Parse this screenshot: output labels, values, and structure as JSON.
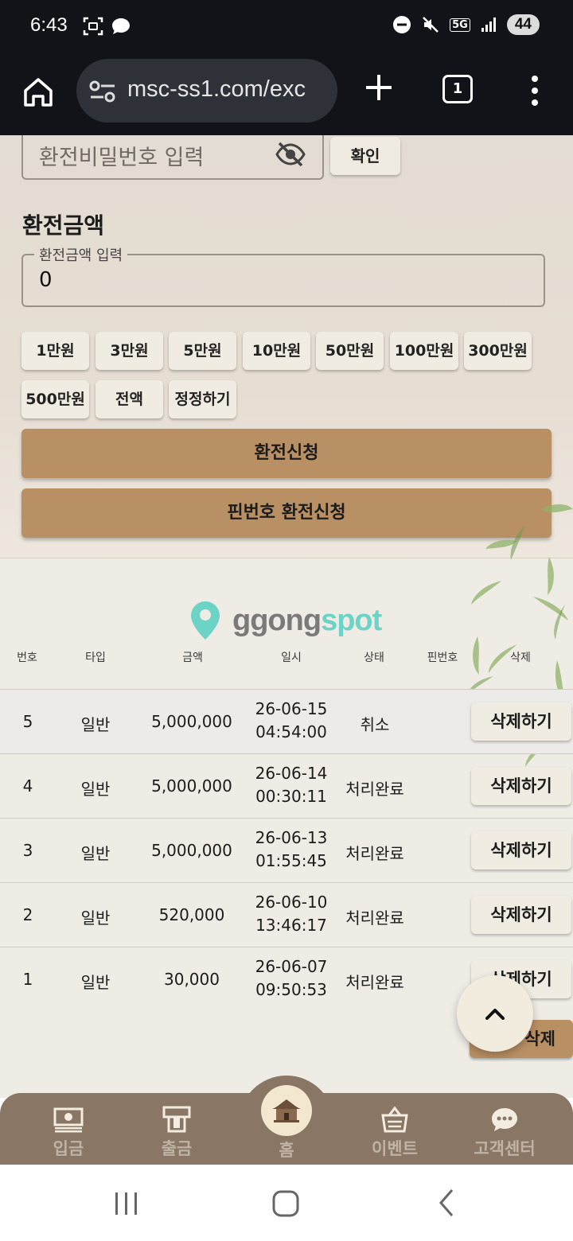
{
  "status_bar": {
    "time": "6:43",
    "network": "5G",
    "battery": "44"
  },
  "browser": {
    "url": "msc-ss1.com/exc",
    "tab_count": "1"
  },
  "form": {
    "password_placeholder": "환전비밀번호 입력",
    "confirm_label": "확인",
    "amount_title": "환전금액",
    "amount_legend": "환전금액 입력",
    "amount_value": "0",
    "chips": [
      "1만원",
      "3만원",
      "5만원",
      "10만원",
      "50만원",
      "100만원",
      "300만원",
      "500만원",
      "전액",
      "정정하기"
    ],
    "exchange_request_label": "환전신청",
    "pin_exchange_label": "핀번호 환전신청"
  },
  "logo": {
    "part1": "ggong",
    "part2": "spot"
  },
  "table": {
    "headers": [
      "번호",
      "타입",
      "금액",
      "일시",
      "상태",
      "핀번호",
      "삭제"
    ],
    "rows": [
      {
        "num": "5",
        "type": "일반",
        "amount": "5,000,000",
        "date": "26-06-15",
        "time": "04:54:00",
        "status": "취소",
        "action": "삭제하기"
      },
      {
        "num": "4",
        "type": "일반",
        "amount": "5,000,000",
        "date": "26-06-14",
        "time": "00:30:11",
        "status": "처리완료",
        "action": "삭제하기"
      },
      {
        "num": "3",
        "type": "일반",
        "amount": "5,000,000",
        "date": "26-06-13",
        "time": "01:55:45",
        "status": "처리완료",
        "action": "삭제하기"
      },
      {
        "num": "2",
        "type": "일반",
        "amount": "520,000",
        "date": "26-06-10",
        "time": "13:46:17",
        "status": "처리완료",
        "action": "삭제하기"
      },
      {
        "num": "1",
        "type": "일반",
        "amount": "30,000",
        "date": "26-06-07",
        "time": "09:50:53",
        "status": "처리완료",
        "action": "삭제하기"
      }
    ],
    "bulk_delete_label": "삭제"
  },
  "bottom_nav": {
    "items": [
      "입금",
      "출금",
      "홈",
      "이벤트",
      "고객센터"
    ]
  },
  "colors": {
    "accent": "#b98f64",
    "nav_bg": "#8a7665",
    "logo_teal": "#6dd3c6"
  }
}
